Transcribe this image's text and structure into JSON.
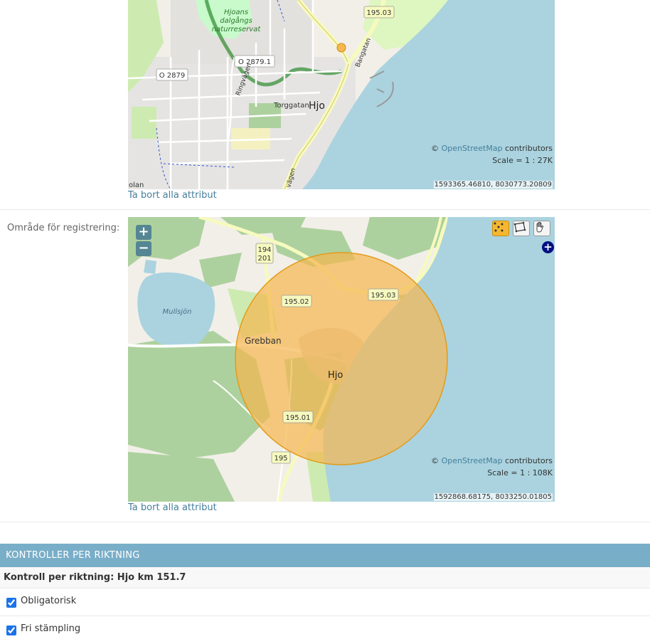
{
  "map_top": {
    "attribution_prefix": "©",
    "attribution_link": "OpenStreetMap",
    "attribution_suffix": "contributors",
    "scale": "Scale = 1 : 27K",
    "coordinates": "1593365.46810, 8030773.20809",
    "labels": {
      "reserve": "Hjoans dalgångs naturreservat",
      "road_19503": "195.03",
      "road_o28791": "O 2879.1",
      "road_o2879": "O 2879",
      "street_torggatan": "Torggatan",
      "street_ringvagen": "Ringvägen",
      "street_bangatan": "Bangatan",
      "street_vagen": "vägen",
      "town": "Hjo",
      "place_edge": "olan"
    }
  },
  "remove_link_1": "Ta bort alla attribut",
  "area_field": {
    "label": "Område för registrering:"
  },
  "map_bottom": {
    "zoom_in": "+",
    "zoom_out": "−",
    "expand": "+",
    "attribution_prefix": "©",
    "attribution_link": "OpenStreetMap",
    "attribution_suffix": "contributors",
    "scale": "Scale = 1 : 108K",
    "coordinates": "1592868.68175, 8033250.01805",
    "tools": [
      "point-tool-icon",
      "polygon-tool-icon",
      "pan-hand-icon"
    ],
    "labels": {
      "road_194": "194",
      "road_201": "201",
      "road_19502": "195.02",
      "road_19503": "195.03",
      "road_19501": "195.01",
      "road_195": "195",
      "lake": "Mullsjön",
      "place_grebban": "Grebban",
      "town": "Hjo"
    }
  },
  "remove_link_2": "Ta bort alla attribut",
  "section": {
    "title": "KONTROLLER PER RIKTNING",
    "subtitle": "Kontroll per riktning: Hjo km 151.7",
    "checkboxes": [
      {
        "label": "Obligatorisk",
        "checked": true
      },
      {
        "label": "Fri stämpling",
        "checked": true
      }
    ]
  },
  "colors": {
    "module_header": "#79aec8",
    "link": "#447e9b",
    "lake": "#aad3df",
    "forest": "#add19e",
    "selection_fill": "#f5b74f",
    "selection_stroke": "#e39b1a"
  }
}
